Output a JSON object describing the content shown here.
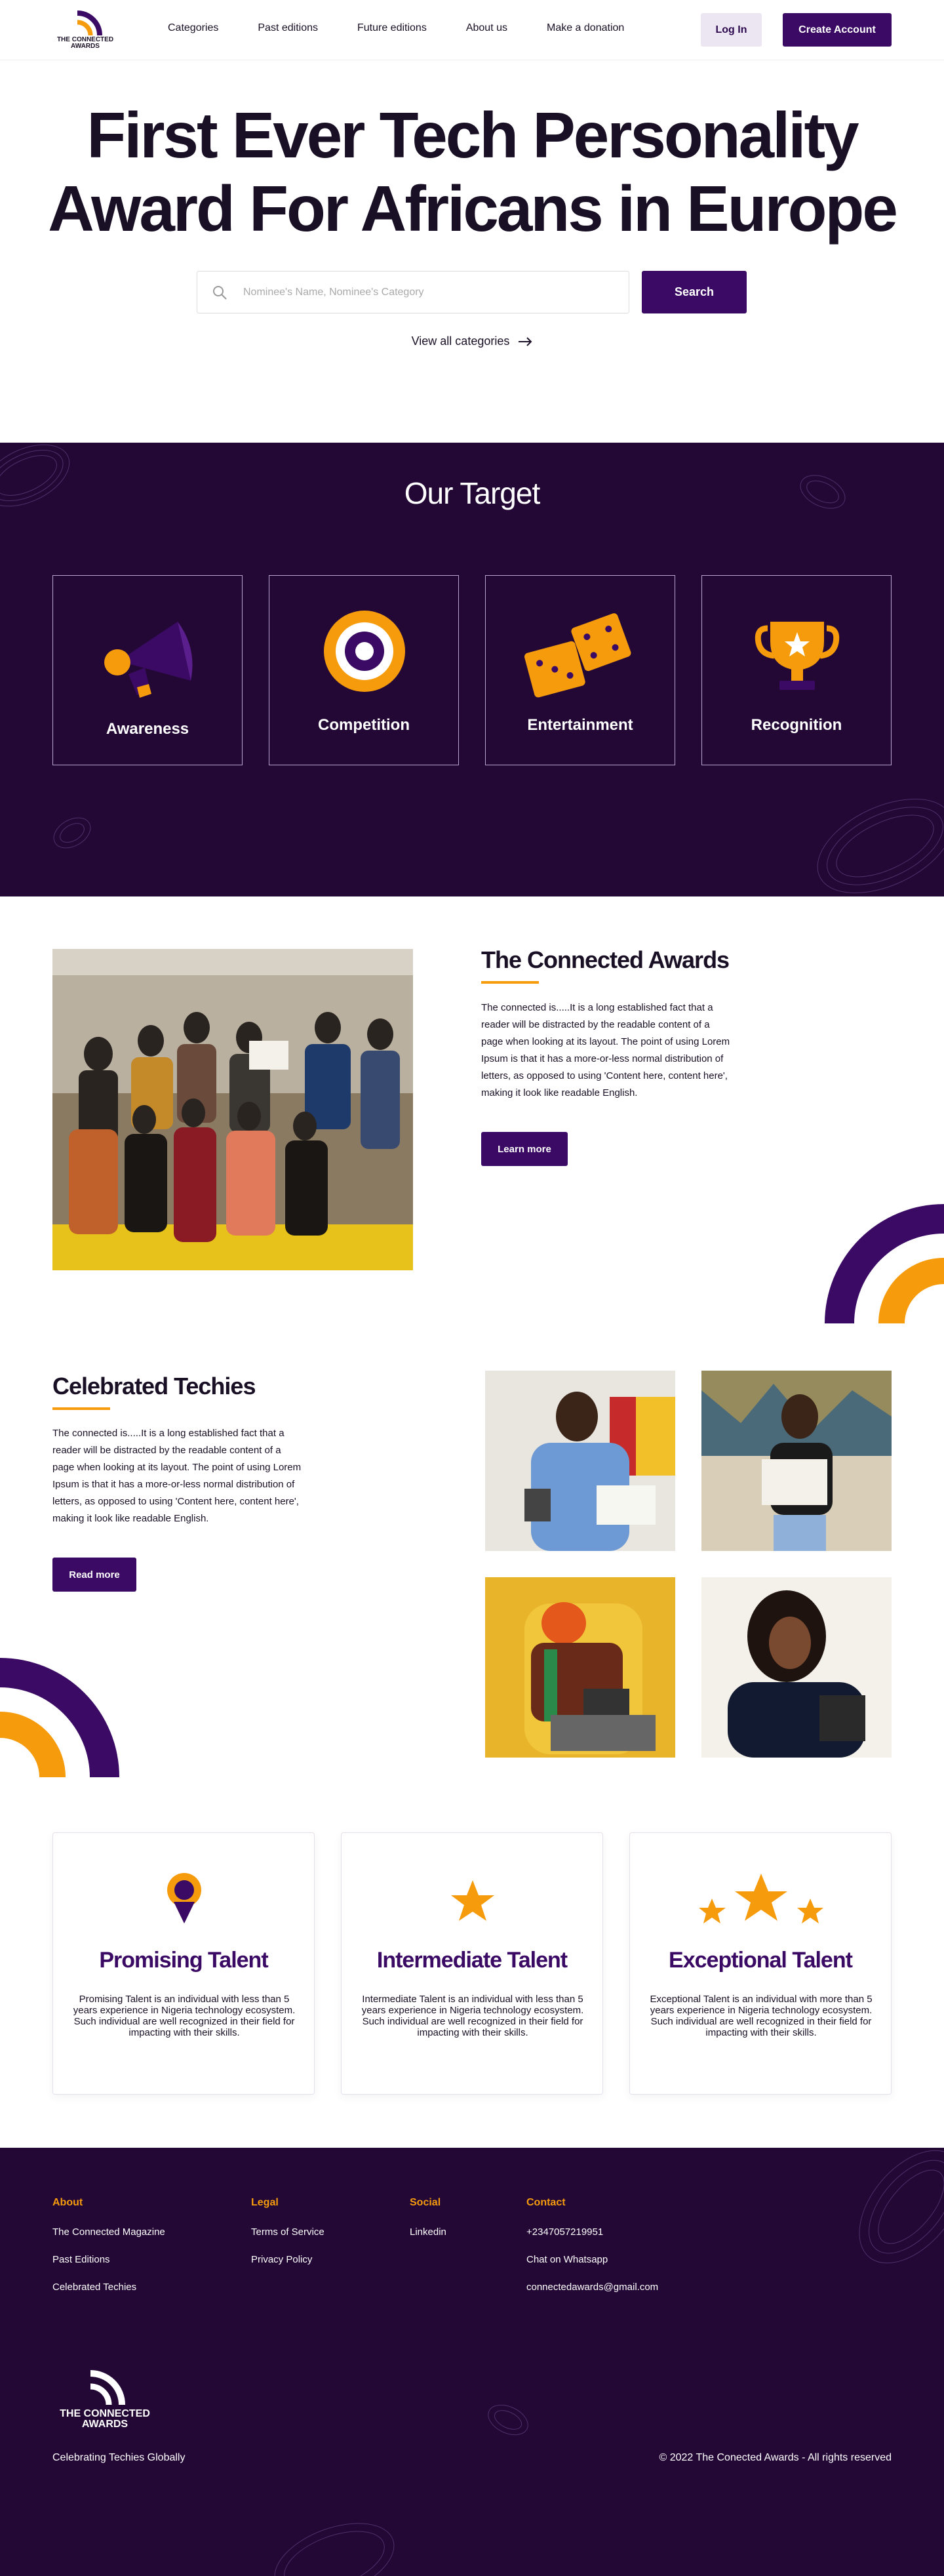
{
  "brand": {
    "name_line1": "THE CONNECTED",
    "name_line2": "AWARDS"
  },
  "colors": {
    "primary": "#3a0a64",
    "dark": "#230836",
    "accent": "#f59b0c"
  },
  "nav": {
    "links": [
      "Categories",
      "Past editions",
      "Future editions",
      "About us",
      "Make a donation"
    ],
    "login": "Log In",
    "create_account": "Create Account"
  },
  "hero": {
    "title_line1": "First Ever Tech Personality",
    "title_line2": "Award For Africans in Europe",
    "search_placeholder": "Nominee's Name, Nominee's Category",
    "search_button": "Search",
    "view_all": "View all categories"
  },
  "target": {
    "title": "Our Target",
    "cards": [
      {
        "label": "Awareness",
        "icon": "megaphone-icon"
      },
      {
        "label": "Competition",
        "icon": "target-icon"
      },
      {
        "label": "Entertainment",
        "icon": "dice-icon"
      },
      {
        "label": "Recognition",
        "icon": "trophy-icon"
      }
    ]
  },
  "about": {
    "title": "The Connected Awards",
    "text": "The connected is.....It is a long established fact that a reader will be distracted by the readable content of a page when looking at its layout. The point of using Lorem Ipsum is that it has a more-or-less normal distribution of letters, as opposed to using 'Content here, content here', making it look like readable English.",
    "button": "Learn more"
  },
  "techies": {
    "title": "Celebrated Techies",
    "text": "The connected is.....It is a long established fact that a reader will be distracted by the readable content of a page when looking at its layout. The point of using Lorem Ipsum is that it has a more-or-less normal distribution of letters, as opposed to using 'Content here, content here', making it look like readable English.",
    "button": "Read more"
  },
  "talents": [
    {
      "title": "Promising Talent",
      "text": "Promising Talent is an individual with less than 5 years experience in Nigeria technology ecosystem. Such individual are well recognized in their field for impacting with their skills."
    },
    {
      "title": "Intermediate Talent",
      "text": "Intermediate Talent is an individual with less than 5 years experience in Nigeria technology ecosystem. Such individual are well recognized in their field for impacting with their skills."
    },
    {
      "title": "Exceptional Talent",
      "text": "Exceptional Talent is an individual with more than 5 years experience in Nigeria technology ecosystem. Such individual are well recognized in their field for impacting with their skills."
    }
  ],
  "footer": {
    "about": {
      "title": "About",
      "links": [
        "The Connected Magazine",
        "Past Editions",
        "Celebrated Techies"
      ]
    },
    "legal": {
      "title": "Legal",
      "links": [
        "Terms of Service",
        "Privacy Policy"
      ]
    },
    "social": {
      "title": "Social",
      "links": [
        "Linkedin"
      ]
    },
    "contact": {
      "title": "Contact",
      "links": [
        "+2347057219951",
        "Chat on Whatsapp",
        "connectedawards@gmail.com"
      ]
    },
    "tagline": "Celebrating Techies Globally",
    "copyright": "© 2022 The Conected Awards - All rights reserved"
  }
}
